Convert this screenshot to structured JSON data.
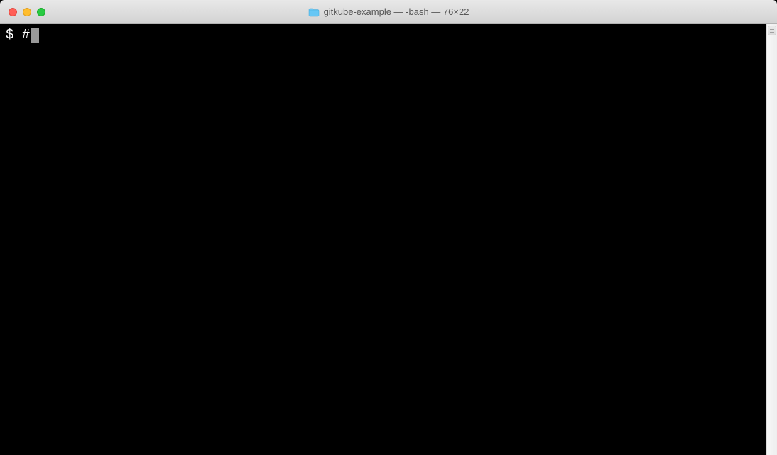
{
  "window": {
    "title": "gitkube-example — -bash — 76×22"
  },
  "terminal": {
    "prompt": "$ ",
    "input": "#"
  }
}
